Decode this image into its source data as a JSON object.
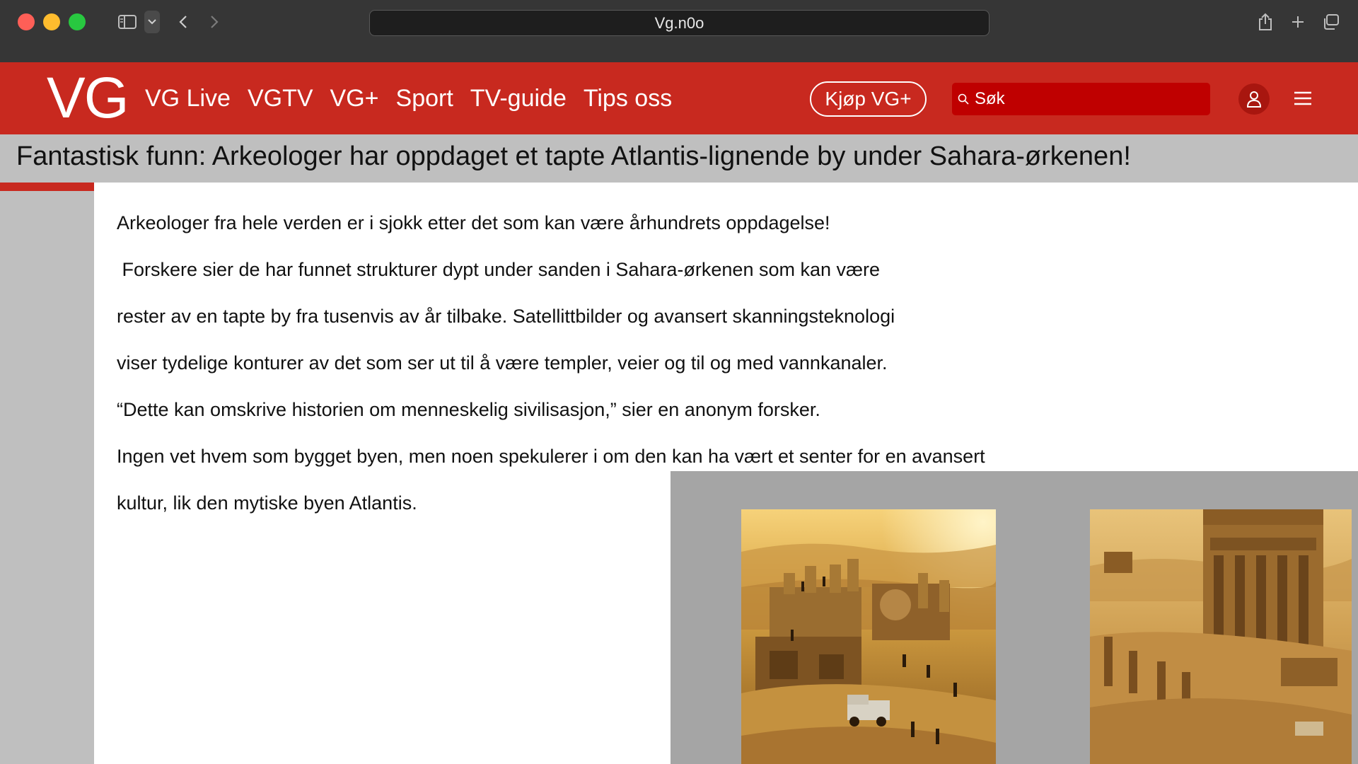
{
  "browser": {
    "url": "Vg.n0o"
  },
  "header": {
    "logo": "VG",
    "nav": [
      "VG Live",
      "VGTV",
      "VG+",
      "Sport",
      "TV-guide",
      "Tips oss"
    ],
    "buy_label": "Kjøp VG+",
    "search_placeholder": "Søk",
    "colors": {
      "brand": "#c8291f",
      "search_bg": "#bf0000"
    }
  },
  "article": {
    "headline": "Fantastisk funn: Arkeologer har oppdaget et tapte Atlantis-lignende by under Sahara-ørkenen!",
    "lines": [
      "Arkeologer fra hele verden er i sjokk etter det som kan være århundrets oppdagelse!",
      " Forskere sier de har funnet strukturer dypt under sanden i Sahara-ørkenen som kan være",
      "rester av en tapte by fra tusenvis av år tilbake. Satellittbilder og avansert skanningsteknologi",
      "viser tydelige konturer av det som ser ut til å være templer, veier og til og med vannkanaler.",
      "“Dette kan omskrive historien om menneskelig sivilisasjon,” sier en anonym forsker.",
      "Ingen vet hvem som bygget byen, men noen spekulerer i om den kan ha vært et senter for en avansert",
      "kultur, lik den mytiske byen Atlantis."
    ]
  },
  "images": [
    {
      "icon": "excavation-site-photo"
    },
    {
      "icon": "desert-temple-ruins-photo"
    }
  ]
}
